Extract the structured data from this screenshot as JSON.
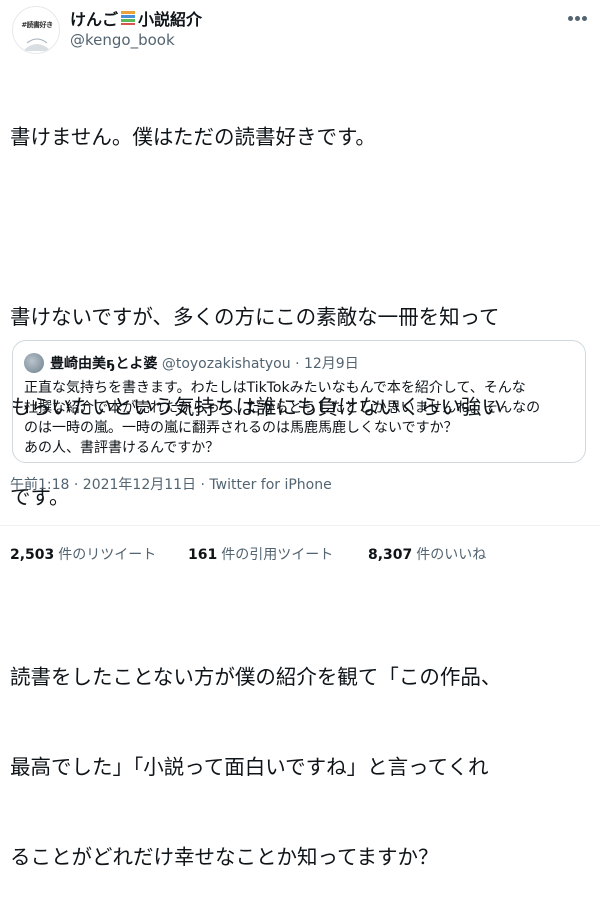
{
  "user": {
    "display_name": "けんご",
    "display_name_suffix": "小説紹介",
    "handle": "@kengo_book",
    "avatar_text": "#読書好き",
    "icons": [
      "books-icon",
      "more-icon"
    ]
  },
  "tweet": {
    "lines": [
      "書けません。僕はただの読書好きです。",
      "",
      "書けないですが、多くの方にこの素敵な一冊を知って",
      "もらいたいという気持ちは誰にも負けないくらい強い",
      "です。",
      "",
      "読書をしたことない方が僕の紹介を観て「この作品、",
      "最高でした」「小説って面白いですね」と言ってくれ",
      "ることがどれだけ幸せなことか知ってますか？"
    ]
  },
  "quote": {
    "name": "豊崎由美ҕとよ婆",
    "handle": "@toyozakishatyou",
    "separator": "·",
    "date": "12月9日",
    "lines": [
      "正直な気持ちを書きます。わたしはTikTokみたいなもんで本を紹介して、そんな",
      "杜撰な紹介で本が売れたからって、だからどうしたとしか思いませんね。そんなの",
      "のは一時の嵐。一時の嵐に翻弄されるのは馬鹿馬鹿しくないですか？",
      "あの人、書評書けるんですか？"
    ]
  },
  "meta": {
    "text": "午前1:18 · 2021年12月11日 · Twitter for iPhone"
  },
  "stats": {
    "retweets": {
      "count": "2,503",
      "label": "件のリツイート"
    },
    "quotes": {
      "count": "161",
      "label": "件の引用ツイート"
    },
    "likes": {
      "count": "8,307",
      "label": "件のいいね"
    }
  },
  "colors": {
    "text": "#0f1419",
    "secondary": "#536471",
    "border": "#cfd9de"
  }
}
